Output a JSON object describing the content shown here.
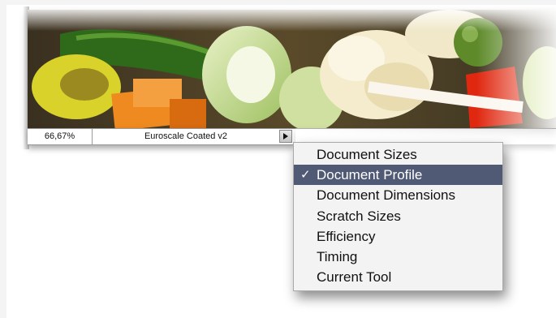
{
  "status_bar": {
    "zoom": "66,67%",
    "profile": "Euroscale Coated v2",
    "menu_button_icon": "triangle-right-icon"
  },
  "popup_menu": {
    "items": [
      {
        "label": "Document Sizes",
        "checked": false
      },
      {
        "label": "Document Profile",
        "checked": true
      },
      {
        "label": "Document Dimensions",
        "checked": false
      },
      {
        "label": "Scratch Sizes",
        "checked": false
      },
      {
        "label": "Efficiency",
        "checked": false
      },
      {
        "label": "Timing",
        "checked": false
      },
      {
        "label": "Current Tool",
        "checked": false
      }
    ],
    "check_glyph": "✓",
    "highlight_color": "#505a74"
  }
}
